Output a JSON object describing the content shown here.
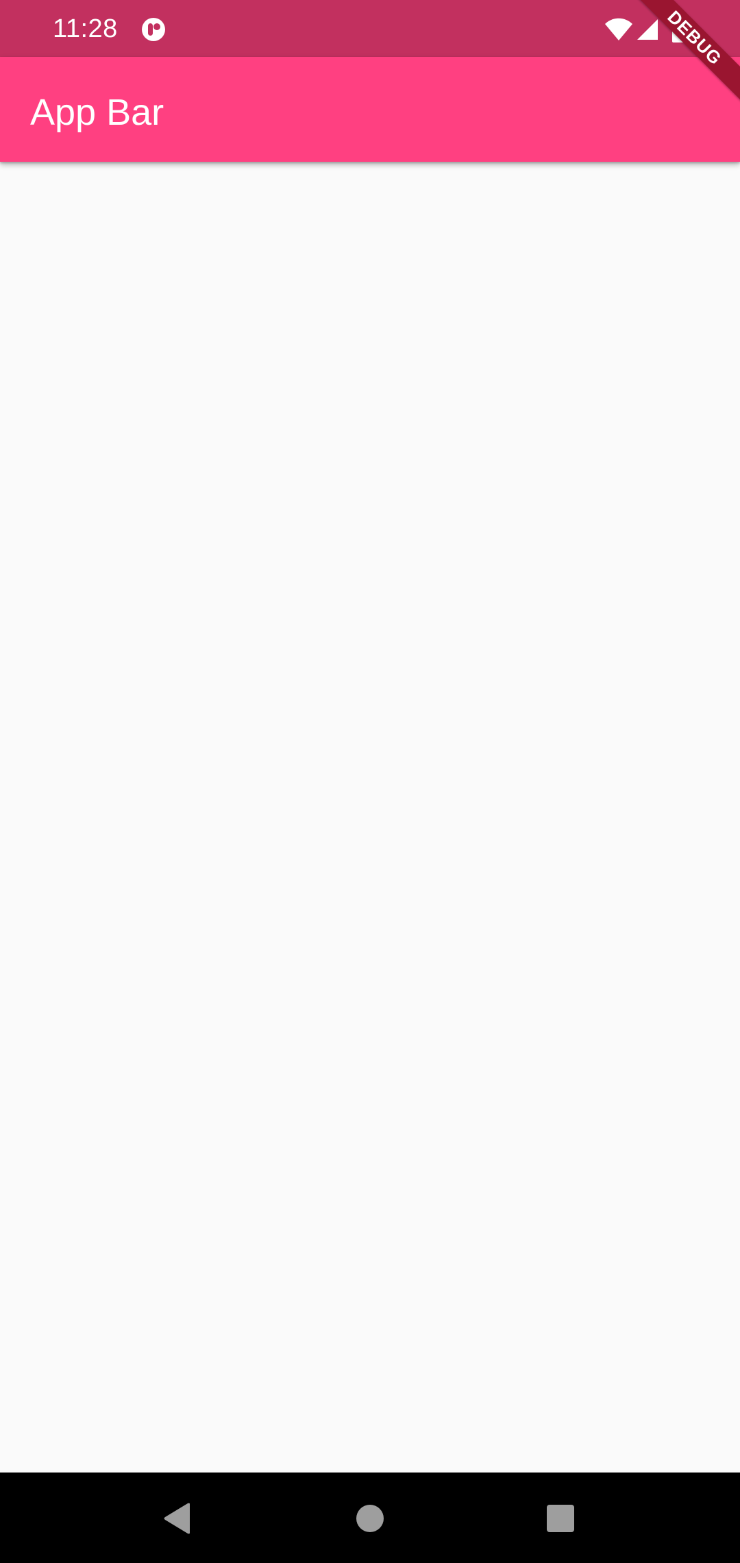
{
  "status_bar": {
    "time": "11:28",
    "app_icon": "notification-app-icon",
    "wifi_icon": "wifi-icon",
    "signal_icon": "cell-signal-icon",
    "battery_icon": "battery-icon",
    "background_color": "#c2305f"
  },
  "app_bar": {
    "title": "App Bar",
    "background_color": "#ff4081"
  },
  "debug_banner": {
    "label": "DEBUG",
    "color": "#9a1530"
  },
  "nav_bar": {
    "back_icon": "back-triangle-icon",
    "home_icon": "home-circle-icon",
    "recents_icon": "recents-square-icon"
  },
  "content": {
    "background_color": "#fafafa"
  }
}
